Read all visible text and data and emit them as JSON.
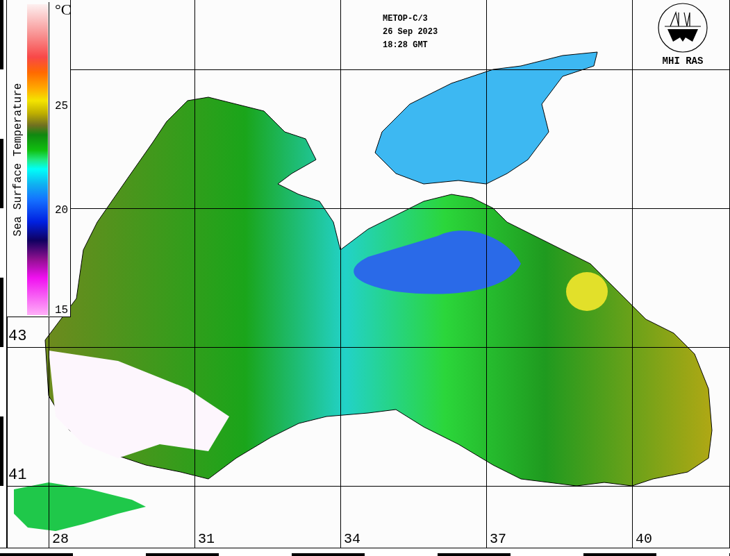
{
  "header": {
    "lines": [
      "METOP-C/3",
      "26 Sep 2023",
      "18:28 GMT"
    ]
  },
  "logo": {
    "text": "MHI RAS"
  },
  "legend": {
    "title": "Sea Surface Temperature",
    "unit": "°C",
    "ticks": [
      "25",
      "20",
      "15"
    ]
  },
  "latitudes": [
    "43",
    "41"
  ],
  "longitudes": [
    "28",
    "31",
    "34",
    "37",
    "40"
  ]
}
